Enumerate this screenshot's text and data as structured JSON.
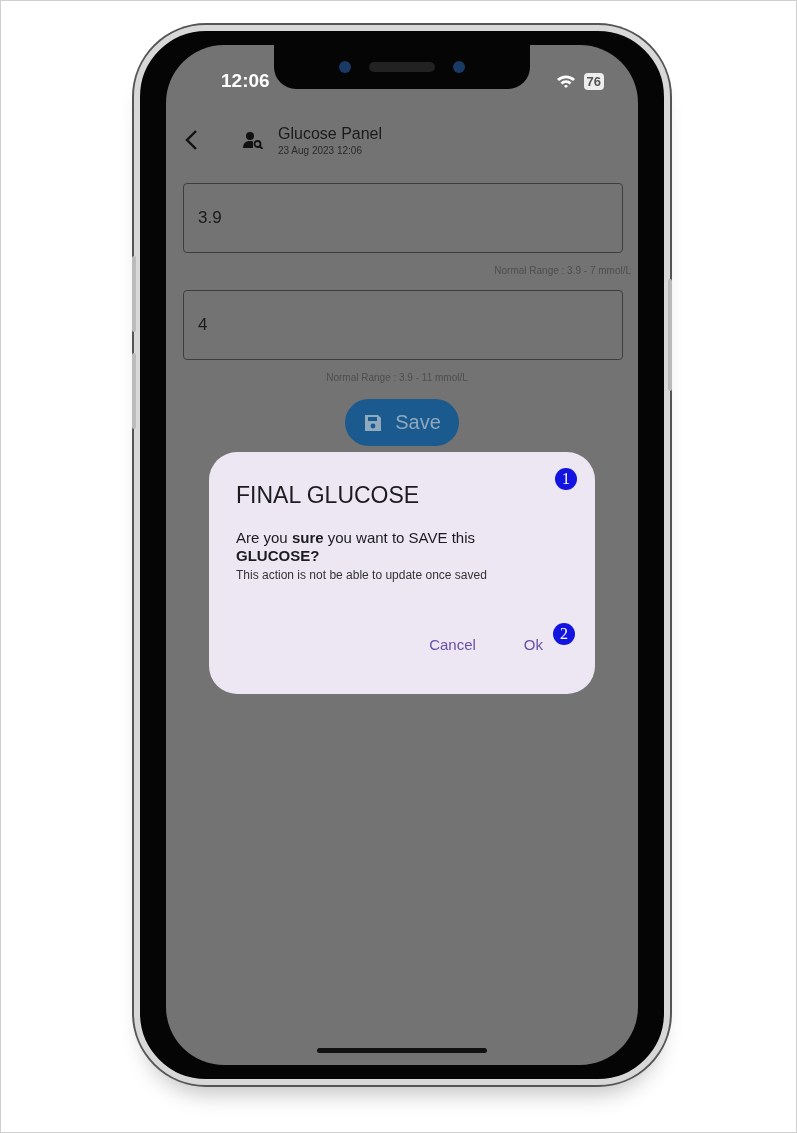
{
  "status_bar": {
    "time": "12:06",
    "battery": "76"
  },
  "header": {
    "title": "Glucose Panel",
    "subtitle": "23 Aug 2023 12:06"
  },
  "fields": [
    {
      "value": "3.9",
      "hint": "Normal Range : 3.9 - 7 mmol/L",
      "kind": "right"
    },
    {
      "value": "4",
      "hint": "Normal Range : 3.9 - 11 mmol/L",
      "kind": "center"
    }
  ],
  "save_button": {
    "label": "Save"
  },
  "dialog": {
    "title": "FINAL GLUCOSE",
    "message": "Are you **sure** you want to SAVE this **GLUCOSE?**",
    "note": "This action is not be able to update once saved",
    "buttons": [
      {
        "label": "Cancel"
      },
      {
        "label": "Ok"
      }
    ]
  },
  "annotations": [
    {
      "label": "1"
    },
    {
      "label": "2"
    }
  ]
}
